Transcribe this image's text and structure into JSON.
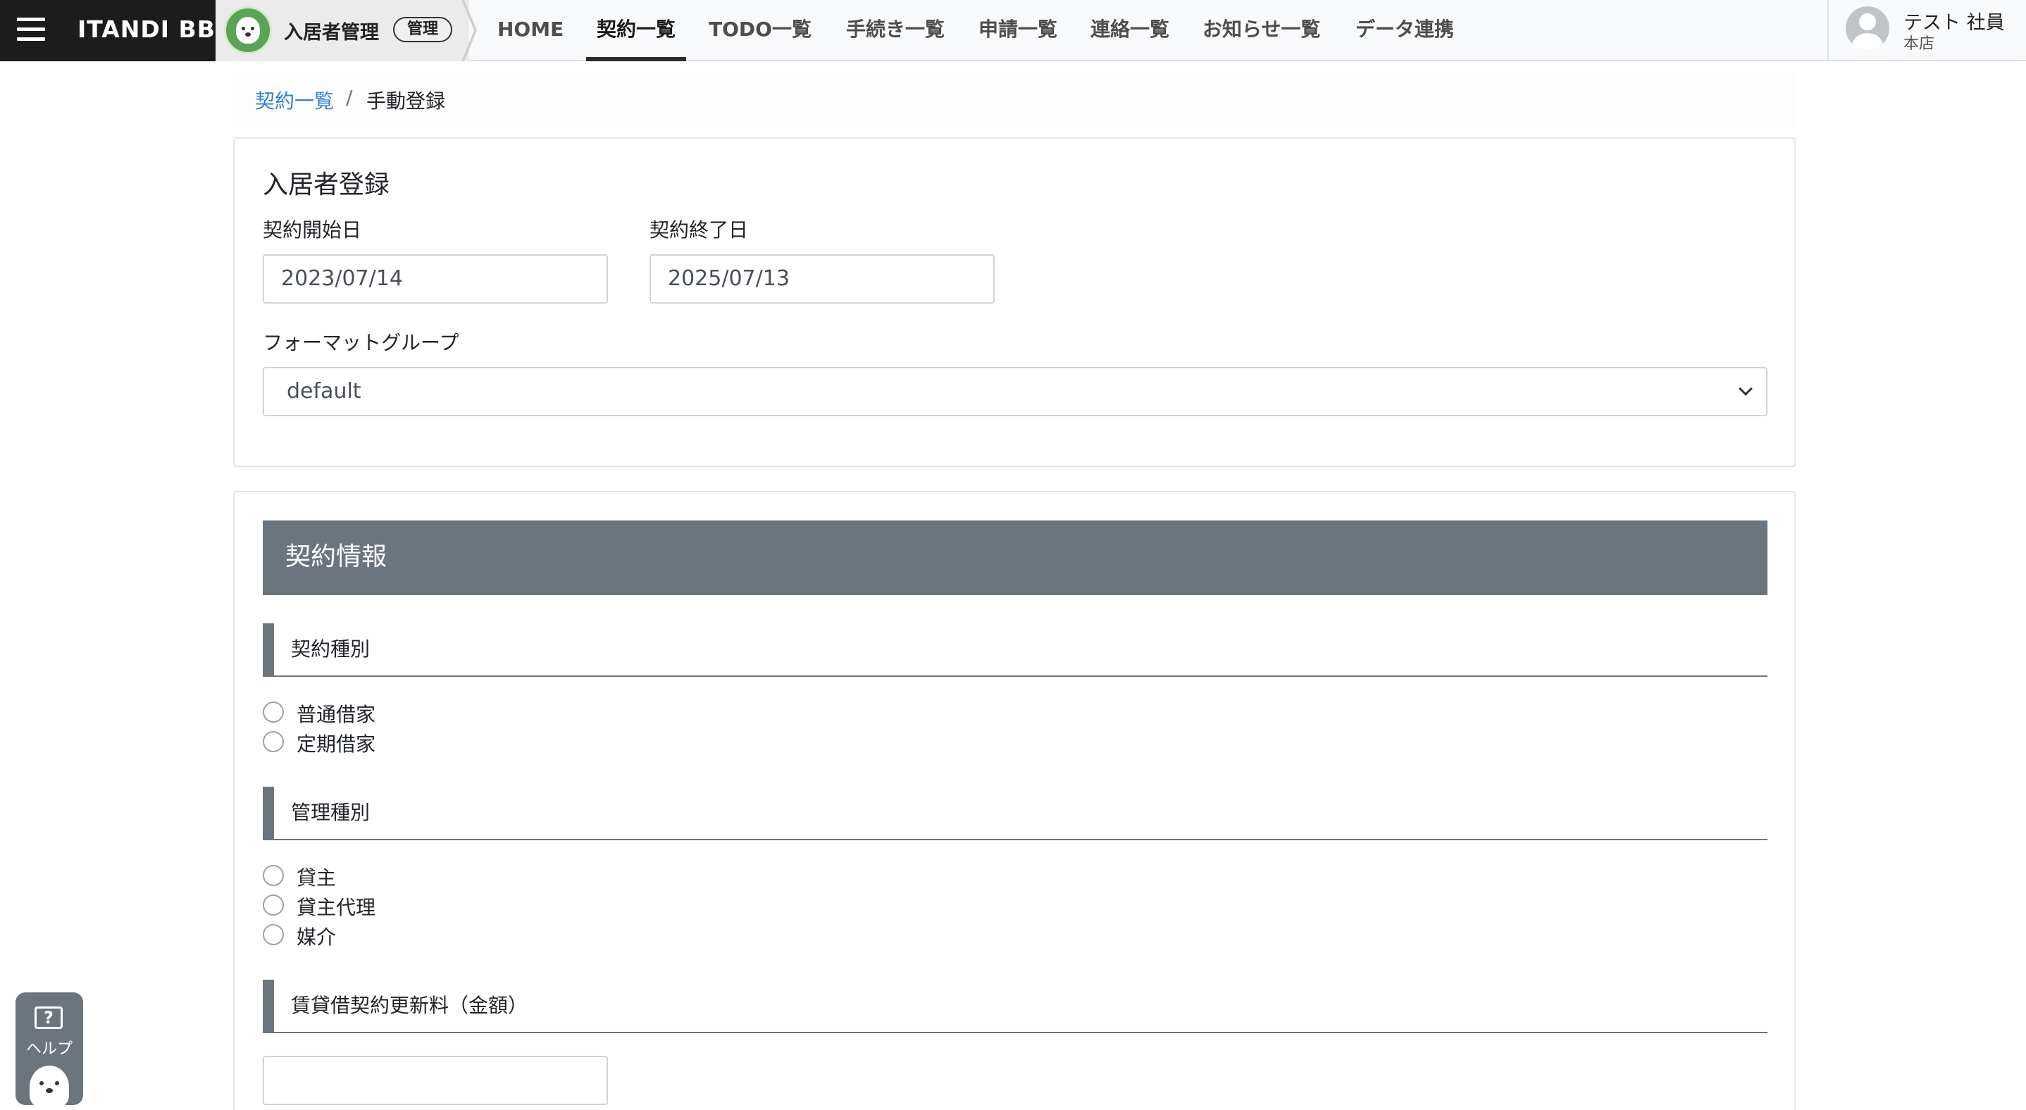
{
  "header": {
    "brand": "ITANDI BB",
    "app_name": "入居者管理",
    "app_badge": "管理",
    "nav": [
      {
        "label": "HOME"
      },
      {
        "label": "契約一覧",
        "active": true
      },
      {
        "label": "TODO一覧"
      },
      {
        "label": "手続き一覧"
      },
      {
        "label": "申請一覧"
      },
      {
        "label": "連絡一覧"
      },
      {
        "label": "お知らせ一覧"
      },
      {
        "label": "データ連携"
      }
    ],
    "user_name": "テスト 社員",
    "user_branch": "本店"
  },
  "breadcrumb": {
    "parent": "契約一覧",
    "separator": "/",
    "current": "手動登録"
  },
  "registration": {
    "title": "入居者登録",
    "start_label": "契約開始日",
    "start_value": "2023/07/14",
    "end_label": "契約終了日",
    "end_value": "2025/07/13",
    "format_label": "フォーマットグループ",
    "format_value": "default"
  },
  "contract": {
    "title": "契約情報",
    "type_heading": "契約種別",
    "type_options": [
      "普通借家",
      "定期借家"
    ],
    "mgmt_heading": "管理種別",
    "mgmt_options": [
      "貸主",
      "貸主代理",
      "媒介"
    ],
    "renewal_heading": "賃貸借契約更新料（金額）",
    "renewal_value": ""
  },
  "help": {
    "label": "ヘルプ",
    "icon_glyph": "?"
  },
  "colors": {
    "section_bar": "#6c757d",
    "link": "#2f7fd8",
    "brand_bg": "#1c1c1c"
  }
}
